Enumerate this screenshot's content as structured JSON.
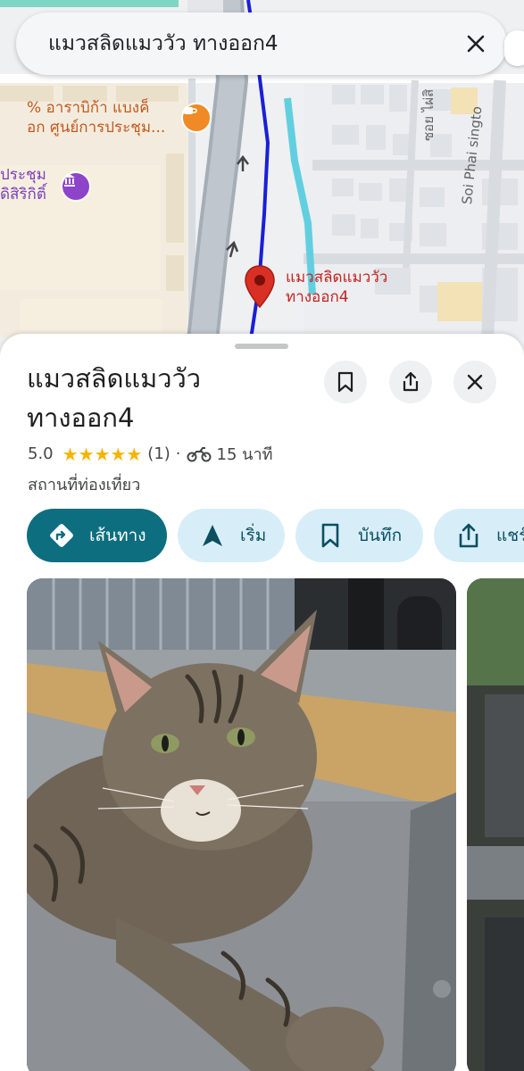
{
  "search": {
    "query": "แมวสลิดแมววัว ทางออก4"
  },
  "map": {
    "poi_cafe": {
      "line1": "% อาราบิก้า แบงค็",
      "line2": "อก ศูนย์การประชุม...",
      "icon": "coffee-icon"
    },
    "poi_conference": {
      "line1": "ประชุม",
      "line2": "ดิสิริกิติ์",
      "icon": "landmark-icon"
    },
    "pin_label": {
      "line1": "แมวสลิดแมววัว",
      "line2": "ทางออก4"
    },
    "streets": [
      "ซอย ไผ่สิ",
      "Soi Phai singto"
    ]
  },
  "place": {
    "title": "แมวสลิดแมววัว ทางออก4",
    "rating": "5.0",
    "stars": "★★★★★",
    "review_count": "(1)",
    "separator": "·",
    "travel_time": "15 นาที",
    "category": "สถานที่ท่องเที่ยว"
  },
  "actions": {
    "directions": "เส้นทาง",
    "start": "เริ่ม",
    "save": "บันทึก",
    "share": "แชร์"
  },
  "colors": {
    "primary": "#0d6e7f",
    "chip_bg": "#d7eef9",
    "star": "#f6b400",
    "pin": "#d93025",
    "route": "#1a1fd6"
  }
}
